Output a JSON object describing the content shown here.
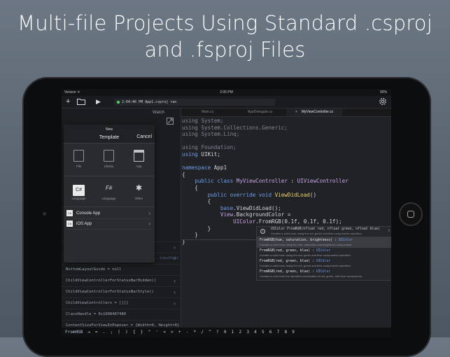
{
  "headline": {
    "line1": "Multi-file Projects Using Standard .csproj",
    "line2": "and .fsproj Files"
  },
  "statusbar": {
    "carrier": "Verizon ᯤ",
    "time": "2:05 PM",
    "battery": "90%"
  },
  "toolbar": {
    "add_icon": "+",
    "folder_icon": "folder-icon",
    "run_icon": "▶",
    "run_status": "2:04:46 PM App1.csproj ran",
    "settings_icon": "gear-icon"
  },
  "sidebar": {
    "tab_label": "Watch",
    "rows": [
      {
        "text": "",
        "has_chevron": true
      },
      {
        "text": "",
        "has_chevron": true
      },
      {
        "text": "BottomLayoutGuide = null",
        "has_chevron": false
      },
      {
        "text": "ChildViewControllerForStatusBarHidden()",
        "has_chevron": true
      },
      {
        "text": "ChildViewControllerForStatusBarStyle()",
        "has_chevron": true
      },
      {
        "text": "ChildViewControllers = [][]",
        "has_chevron": true
      },
      {
        "text": "ClassHandle = 0x1008487480",
        "has_chevron": false
      },
      {
        "text": "ContentSizeForViewInPopover = {Width=0, Height=0}",
        "has_chevron": false
      }
    ],
    "side_note": "...tionsToShi"
  },
  "new_popover": {
    "title": "New",
    "subtitle": "Template",
    "cancel": "Cancel",
    "types": [
      {
        "icon": "file-icon",
        "label": "File"
      },
      {
        "icon": "library-icon",
        "label": "Library"
      },
      {
        "icon": "app-icon",
        "label": "App"
      }
    ],
    "languages": [
      {
        "icon": "C#",
        "label": "Language"
      },
      {
        "icon": "F#",
        "label": "Language"
      },
      {
        "icon": "✱",
        "label": "Other"
      }
    ],
    "items": [
      {
        "icon": "C#",
        "label": "Console App"
      },
      {
        "icon": "C#",
        "label": "iOS App"
      }
    ]
  },
  "editor": {
    "tabs": [
      {
        "label": "Main.cs",
        "active": false
      },
      {
        "label": "AppDelegate.cs",
        "active": false
      },
      {
        "label": "MyViewController.cs",
        "active": true
      }
    ],
    "close_icon": "×"
  },
  "completion": {
    "header_sig": "UIColor FromRGB(nfloat red, nfloat green, nfloat blue)",
    "header_desc": "Creates a solid color using the red, green and blue components specified.",
    "items": [
      {
        "sig": "FromHSB(hue, saturation, brightness)",
        "ret": "UIColor",
        "desc": "Creates a color from using the hue, saturation and brightness components.",
        "selected": true
      },
      {
        "sig": "FromRGB(red, green, blue)",
        "ret": "UIColor",
        "desc": "Creates a solid color using the red, green and blue components specified.",
        "selected": false
      },
      {
        "sig": "FromRGB(red, green, blue)",
        "ret": "UIColor",
        "desc": "Creates a solid color using the red, green and blue components specified.",
        "selected": false
      },
      {
        "sig": "FromRGB(red, green, blue)",
        "ret": "UIColor",
        "desc": "Creates a color from the specified combinated of red, green, and blue components.",
        "selected": false
      }
    ]
  },
  "keybar": {
    "current": "FromHSB",
    "keys": "⇥ = . ; ( ) { } \" ' < > + - * / ^ ? 0 1 2 3 4 5 6 7 8 9"
  },
  "colors": {
    "keyword": "#6f9ef0",
    "type": "#c9a4e8",
    "method": "#f0d36a"
  }
}
